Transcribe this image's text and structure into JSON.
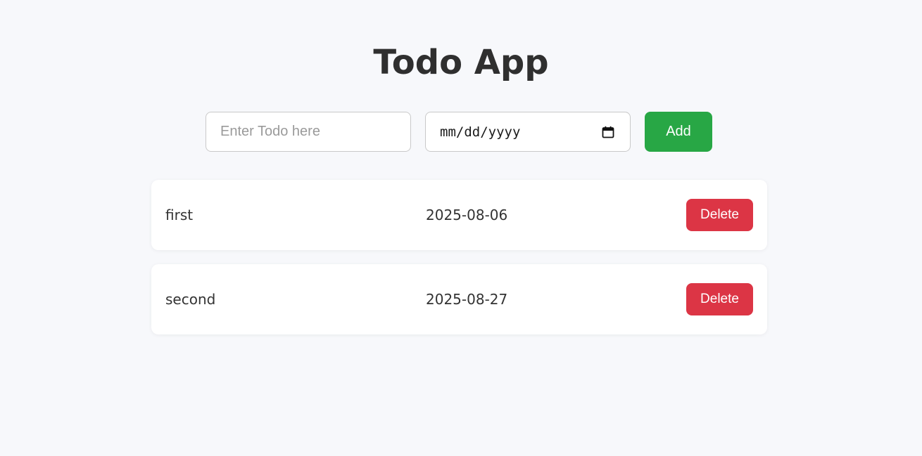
{
  "header": {
    "title": "Todo App"
  },
  "form": {
    "todo_placeholder": "Enter Todo here",
    "todo_value": "",
    "date_placeholder": "mm/dd/yyyy",
    "date_value": "",
    "add_label": "Add",
    "calendar_icon": "calendar-icon"
  },
  "todos": [
    {
      "name": "first",
      "date": "2025-08-06",
      "delete_label": "Delete"
    },
    {
      "name": "second",
      "date": "2025-08-27",
      "delete_label": "Delete"
    }
  ],
  "colors": {
    "background": "#f7f8fb",
    "add_button": "#28a745",
    "delete_button": "#dc3545",
    "title_text": "#2f2f2f"
  }
}
